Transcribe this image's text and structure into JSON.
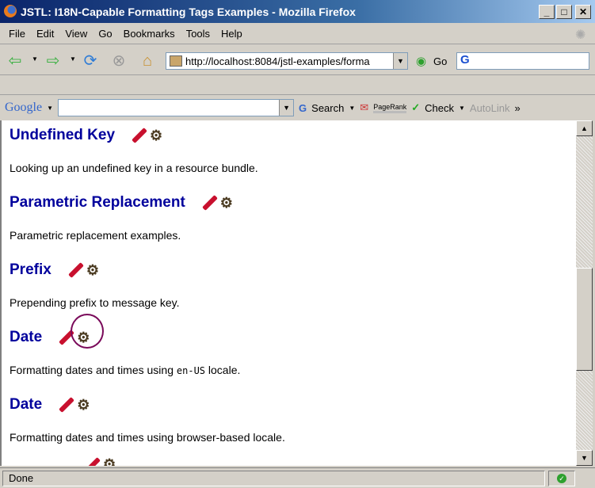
{
  "window": {
    "title": "JSTL: I18N-Capable Formatting Tags Examples - Mozilla Firefox"
  },
  "menu": [
    "File",
    "Edit",
    "View",
    "Go",
    "Bookmarks",
    "Tools",
    "Help"
  ],
  "nav": {
    "url": "http://localhost:8084/jstl-examples/forma",
    "go_label": "Go",
    "search_engine": "G"
  },
  "google_toolbar": {
    "logo": "Google",
    "search_label": "Search",
    "pagerank_label": "PageRank",
    "check_label": "Check",
    "autolink_label": "AutoLink",
    "more": "»"
  },
  "sections": [
    {
      "title": "Undefined Key",
      "desc": "Looking up an undefined key in a resource bundle."
    },
    {
      "title": "Parametric Replacement",
      "desc": "Parametric replacement examples."
    },
    {
      "title": "Prefix",
      "desc": "Prepending prefix to message key."
    },
    {
      "title": "Date",
      "desc_pre": "Formatting dates and times using ",
      "desc_code": "en-US",
      "desc_post": " locale."
    },
    {
      "title": "Date",
      "desc": "Formatting dates and times using browser-based locale."
    }
  ],
  "status": {
    "text": "Done"
  }
}
